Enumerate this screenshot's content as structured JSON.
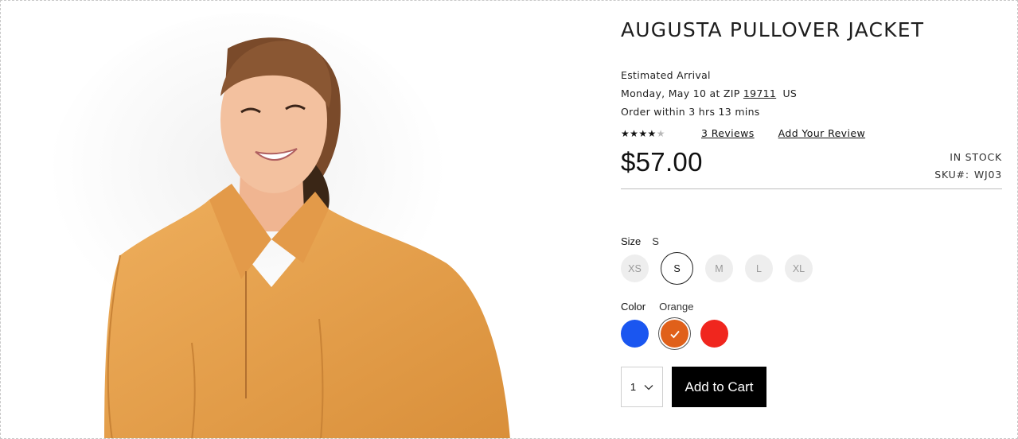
{
  "product": {
    "title": "AUGUSTA PULLOVER JACKET",
    "image_alt": "Woman wearing orange pullover jacket"
  },
  "arrival": {
    "label": "Estimated Arrival",
    "date_prefix": "Monday, May 10 at ZIP",
    "zip": "19711",
    "country": "US",
    "order_within": "Order within 3 hrs 13 mins"
  },
  "rating": {
    "stars_filled": 4.5,
    "stars_total": 5,
    "reviews_link": "3 Reviews",
    "add_review_link": "Add Your Review"
  },
  "price": "$57.00",
  "stock": {
    "status": "IN STOCK",
    "sku_label": "SKU#:",
    "sku_value": "WJ03"
  },
  "size": {
    "label": "Size",
    "selected": "S",
    "options": [
      "XS",
      "S",
      "M",
      "L",
      "XL"
    ]
  },
  "color": {
    "label": "Color",
    "selected": "Orange",
    "options": [
      {
        "name": "Blue",
        "hex": "#1a56f0"
      },
      {
        "name": "Orange",
        "hex": "#e0601a"
      },
      {
        "name": "Red",
        "hex": "#f0261e"
      }
    ]
  },
  "cart": {
    "quantity": "1",
    "add_label": "Add to Cart"
  },
  "colors": {
    "jacket": "#e7a24f",
    "button_bg": "#000000"
  }
}
